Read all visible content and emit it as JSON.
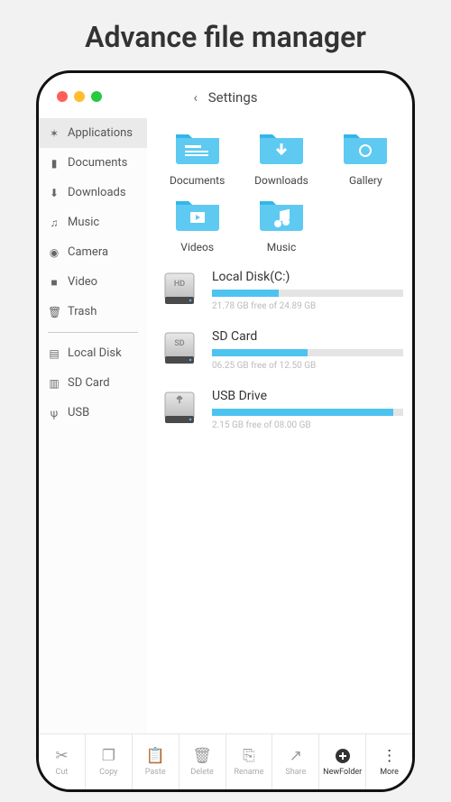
{
  "page_title": "Advance file manager",
  "header": {
    "back_glyph": "‹",
    "title": "Settings"
  },
  "sidebar": {
    "items": [
      {
        "icon": "✶",
        "label": "Applications",
        "active": true
      },
      {
        "icon": "▮",
        "label": "Documents"
      },
      {
        "icon": "⬇",
        "label": "Downloads"
      },
      {
        "icon": "♫",
        "label": "Music"
      },
      {
        "icon": "◉",
        "label": "Camera"
      },
      {
        "icon": "■",
        "label": "Video"
      },
      {
        "icon": "🗑",
        "label": "Trash"
      }
    ],
    "storage": [
      {
        "icon": "▤",
        "label": "Local Disk"
      },
      {
        "icon": "▥",
        "label": "SD Card"
      },
      {
        "icon": "ψ",
        "label": "USB"
      }
    ]
  },
  "folders": [
    {
      "name": "Documents",
      "glyph": "doc"
    },
    {
      "name": "Downloads",
      "glyph": "down"
    },
    {
      "name": "Gallery",
      "glyph": "gallery"
    },
    {
      "name": "Videos",
      "glyph": "video"
    },
    {
      "name": "Music",
      "glyph": "music"
    }
  ],
  "drives": [
    {
      "name": "Local Disk(C:)",
      "badge": "HD",
      "free": "21.78 GB free of 24.89 GB",
      "pct": 35
    },
    {
      "name": "SD Card",
      "badge": "SD",
      "free": "06.25 GB free of 12.50 GB",
      "pct": 50
    },
    {
      "name": "USB Drive",
      "badge": "usb",
      "free": "2.15 GB free of 08.00 GB",
      "pct": 95
    }
  ],
  "toolbar": [
    {
      "label": "Cut",
      "glyph": "✂"
    },
    {
      "label": "Copy",
      "glyph": "❐"
    },
    {
      "label": "Paste",
      "glyph": "📋"
    },
    {
      "label": "Delete",
      "glyph": "🗑"
    },
    {
      "label": "Rename",
      "glyph": "⎘"
    },
    {
      "label": "Share",
      "glyph": "↗"
    },
    {
      "label": "NewFolder",
      "glyph": "＋",
      "dark": true
    },
    {
      "label": "More",
      "glyph": "⋮",
      "dark": true
    }
  ],
  "colors": {
    "folder": "#5ecaf2",
    "folder_dark": "#34b6e8"
  }
}
